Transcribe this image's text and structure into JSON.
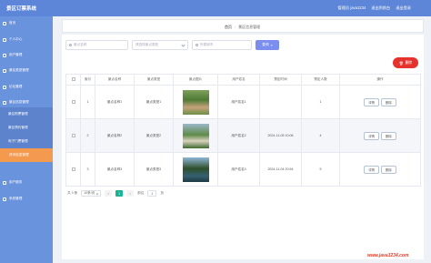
{
  "header": {
    "title": "景区订票系统",
    "user_label": "管理员 java1234",
    "home_link": "退出到前台",
    "logout_link": "退出登录"
  },
  "sidebar": {
    "items": [
      {
        "label": "首页"
      },
      {
        "label": "个人中心"
      },
      {
        "label": "用户管理"
      },
      {
        "label": "景区类型管理"
      },
      {
        "label": "论坛管理"
      },
      {
        "label": "景区信息管理"
      },
      {
        "label": "景区购票管理"
      },
      {
        "label": "景区预约管理"
      },
      {
        "label": "电子门票管理"
      },
      {
        "label": "资讯信息管理"
      },
      {
        "label": "用户服务"
      },
      {
        "label": "系统管理"
      }
    ]
  },
  "breadcrumb": {
    "home": "首页",
    "current": "景区信息管理"
  },
  "search": {
    "name_placeholder": "景点名称",
    "type_placeholder": "请选择景点类型",
    "city_placeholder": "所属城市",
    "query_label": "查询"
  },
  "toolbar": {
    "delete_label": "删除"
  },
  "table": {
    "headers": [
      "",
      "索引",
      "景点名称",
      "景点类型",
      "景点图片",
      "用户姓名",
      "预定时间",
      "预定人数",
      "操作"
    ],
    "rows": [
      {
        "index": "1",
        "name": "景点名称1",
        "type": "景点类型1",
        "user": "用户姓名1",
        "time": "",
        "count": "1"
      },
      {
        "index": "2",
        "name": "景点名称2",
        "type": "景点类型2",
        "user": "用户姓名2",
        "time": "2024-11-05 10:06",
        "count": "4"
      },
      {
        "index": "3",
        "name": "景点名称3",
        "type": "景点类型3",
        "user": "用户姓名3",
        "time": "2024-11-04 20:54",
        "count": "5"
      }
    ],
    "detail_label": "详情",
    "delete_label": "删除"
  },
  "pagination": {
    "total": "共 3 条",
    "page_size": "10条/页",
    "prev": "<",
    "current": "1",
    "next": ">",
    "goto": "前往",
    "goto_value": "1",
    "page_unit": "页"
  },
  "watermark": "www.java1234.com",
  "colors": {
    "topbar": "#5d86d8",
    "sidebar": "#6a93de",
    "active": "#f39a4f",
    "danger": "#e5322d",
    "primary": "#7b8ef0"
  }
}
